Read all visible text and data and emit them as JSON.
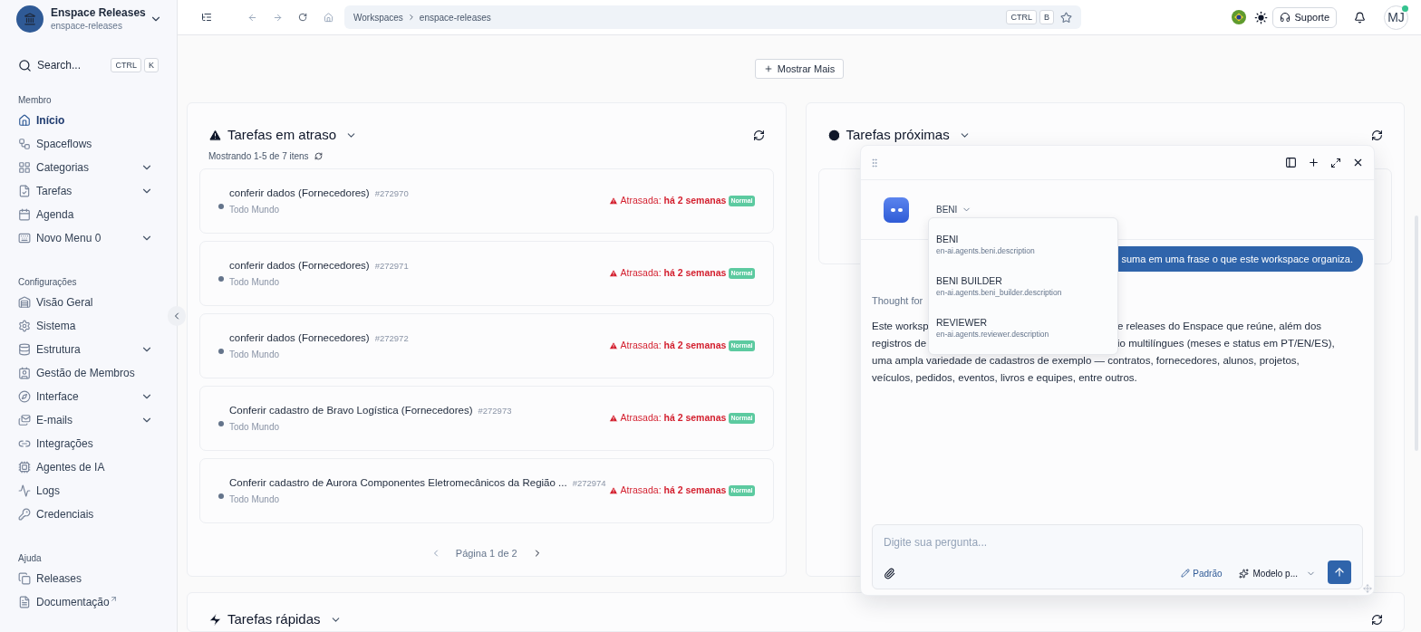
{
  "workspace": {
    "name": "Enspace Releases",
    "slug": "enspace-releases"
  },
  "search": {
    "label": "Search...",
    "keys": [
      "CTRL",
      "K"
    ]
  },
  "sidebar": {
    "sections": [
      {
        "title": "Membro",
        "items": [
          {
            "label": "Início",
            "kind": "home",
            "selected": true,
            "expandable": false
          },
          {
            "label": "Spaceflows",
            "kind": "flow",
            "selected": false,
            "expandable": false
          },
          {
            "label": "Categorias",
            "kind": "grid",
            "selected": false,
            "expandable": true
          },
          {
            "label": "Tarefas",
            "kind": "task",
            "selected": false,
            "expandable": true
          },
          {
            "label": "Agenda",
            "kind": "calendar",
            "selected": false,
            "expandable": false
          },
          {
            "label": "Novo Menu 0",
            "kind": "keyboard",
            "selected": false,
            "expandable": true
          }
        ]
      },
      {
        "title": "Configurações",
        "items": [
          {
            "label": "Visão Geral",
            "kind": "overview",
            "selected": false,
            "expandable": false
          },
          {
            "label": "Sistema",
            "kind": "settings",
            "selected": false,
            "expandable": false
          },
          {
            "label": "Estrutura",
            "kind": "database",
            "selected": false,
            "expandable": true
          },
          {
            "label": "Gestão de Membros",
            "kind": "members",
            "selected": false,
            "expandable": false
          },
          {
            "label": "Interface",
            "kind": "compass",
            "selected": false,
            "expandable": true
          },
          {
            "label": "E-mails",
            "kind": "mail",
            "selected": false,
            "expandable": true
          },
          {
            "label": "Integrações",
            "kind": "link",
            "selected": false,
            "expandable": false
          },
          {
            "label": "Agentes de IA",
            "kind": "cpu",
            "selected": false,
            "expandable": false
          },
          {
            "label": "Logs",
            "kind": "activity",
            "selected": false,
            "expandable": false
          },
          {
            "label": "Credenciais",
            "kind": "key",
            "selected": false,
            "expandable": false
          }
        ]
      },
      {
        "title": "Ajuda",
        "items": [
          {
            "label": "Releases",
            "kind": "copy",
            "selected": false,
            "expandable": false
          },
          {
            "label": "Documentação",
            "kind": "doc",
            "selected": false,
            "expandable": false,
            "external": true
          }
        ]
      }
    ]
  },
  "topbar": {
    "breadcrumbs": [
      "Workspaces",
      "enspace-releases"
    ],
    "shortcut": [
      "CTRL",
      "B"
    ],
    "support": "Suporte",
    "avatar": "MJ"
  },
  "show_more": "Mostrar Mais",
  "overdue": {
    "title": "Tarefas em atraso",
    "summary": "Mostrando 1-5 de 7 itens",
    "pagination": "Página 1 de 2",
    "tasks": [
      {
        "title": "conferir dados (Fornecedores)",
        "id": "#272970",
        "assignee": "Todo Mundo",
        "status": "Atrasada: **há 2 semanas**",
        "priority": "Normal"
      },
      {
        "title": "conferir dados (Fornecedores)",
        "id": "#272971",
        "assignee": "Todo Mundo",
        "status": "Atrasada: **há 2 semanas**",
        "priority": "Normal"
      },
      {
        "title": "conferir dados (Fornecedores)",
        "id": "#272972",
        "assignee": "Todo Mundo",
        "status": "Atrasada: **há 2 semanas**",
        "priority": "Normal"
      },
      {
        "title": "Conferir cadastro de Bravo Logística (Fornecedores)",
        "id": "#272973",
        "assignee": "Todo Mundo",
        "status": "Atrasada: **há 2 semanas**",
        "priority": "Normal"
      },
      {
        "title": "Conferir cadastro de Aurora Componentes Eletromecânicos da Região ...",
        "id": "#272974",
        "assignee": "Todo Mundo",
        "status": "Atrasada: **há 2 semanas**",
        "priority": "Normal"
      }
    ]
  },
  "upcoming": {
    "title": "Tarefas próximas"
  },
  "quick": {
    "title": "Tarefas rápidas"
  },
  "chat": {
    "agent": "BENI",
    "agents": [
      {
        "name": "BENI",
        "description": "en-ai.agents.beni.description"
      },
      {
        "name": "BENI BUILDER",
        "description": "en-ai.agents.beni_builder.description"
      },
      {
        "name": "REVIEWER",
        "description": "en-ai.agents.reviewer.description"
      }
    ],
    "user_message": "suma em uma frase o que este workspace organiza.",
    "thought": "Thought for",
    "answer_lines": [
      [
        "Este worksp",
        "e releases do Enspace que reúne, além dos"
      ],
      [
        "registros de",
        "io multilíngues (meses e status em PT/EN/ES),"
      ],
      [
        "uma ampla variedade de cadastros de exemplo — contratos, fornecedores, alunos, projetos,"
      ],
      [
        "veículos, pedidos, eventos, livros e equipes, entre outros."
      ]
    ],
    "placeholder": "Digite sua pergunta...",
    "mode": "Padrão",
    "model": "Modelo p..."
  }
}
